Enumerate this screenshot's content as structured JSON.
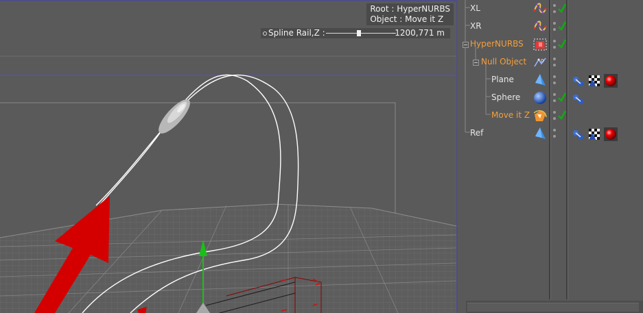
{
  "viewport": {
    "hud": {
      "root_line": "Root : HyperNURBS",
      "object_line": "Object : Move it Z"
    },
    "spline_rail": {
      "label": "Spline Rail,Z :",
      "value": "-1200,771 m",
      "slider_fraction": 0.47
    }
  },
  "object_manager": {
    "rows": [
      {
        "name": "XL",
        "icon": "spline-icon",
        "color": "default",
        "check": true,
        "tags": []
      },
      {
        "name": "XR",
        "icon": "spline-icon",
        "color": "default",
        "check": true,
        "tags": []
      },
      {
        "name": "HyperNURBS",
        "icon": "hypernurbs-icon",
        "color": "orange",
        "check": true,
        "tags": []
      },
      {
        "name": "Null Object",
        "icon": "null-object-icon",
        "color": "orange",
        "check": false,
        "tags": []
      },
      {
        "name": "Plane",
        "icon": "plane-icon",
        "color": "default",
        "check": false,
        "tags": [
          "phong-tag-icon",
          "texture-tag-icon",
          "material-tag-icon"
        ]
      },
      {
        "name": "Sphere",
        "icon": "sphere-icon",
        "color": "default",
        "check": true,
        "tags": [
          "phong-tag-icon"
        ]
      },
      {
        "name": "Move it Z",
        "icon": "spline-rail-icon",
        "color": "orange",
        "check": true,
        "tags": []
      },
      {
        "name": "Ref",
        "icon": "plane-icon",
        "color": "default",
        "check": false,
        "tags": [
          "phong-tag-icon",
          "texture-tag-icon",
          "material-tag-icon"
        ]
      }
    ]
  },
  "colors": {
    "viewport_bg": "#5a5a5a",
    "panel_bg": "#595959",
    "active_name": "#f3a03c",
    "arrow_red": "#d40000",
    "axis_green": "#18c018",
    "check_green": "#14a814"
  }
}
